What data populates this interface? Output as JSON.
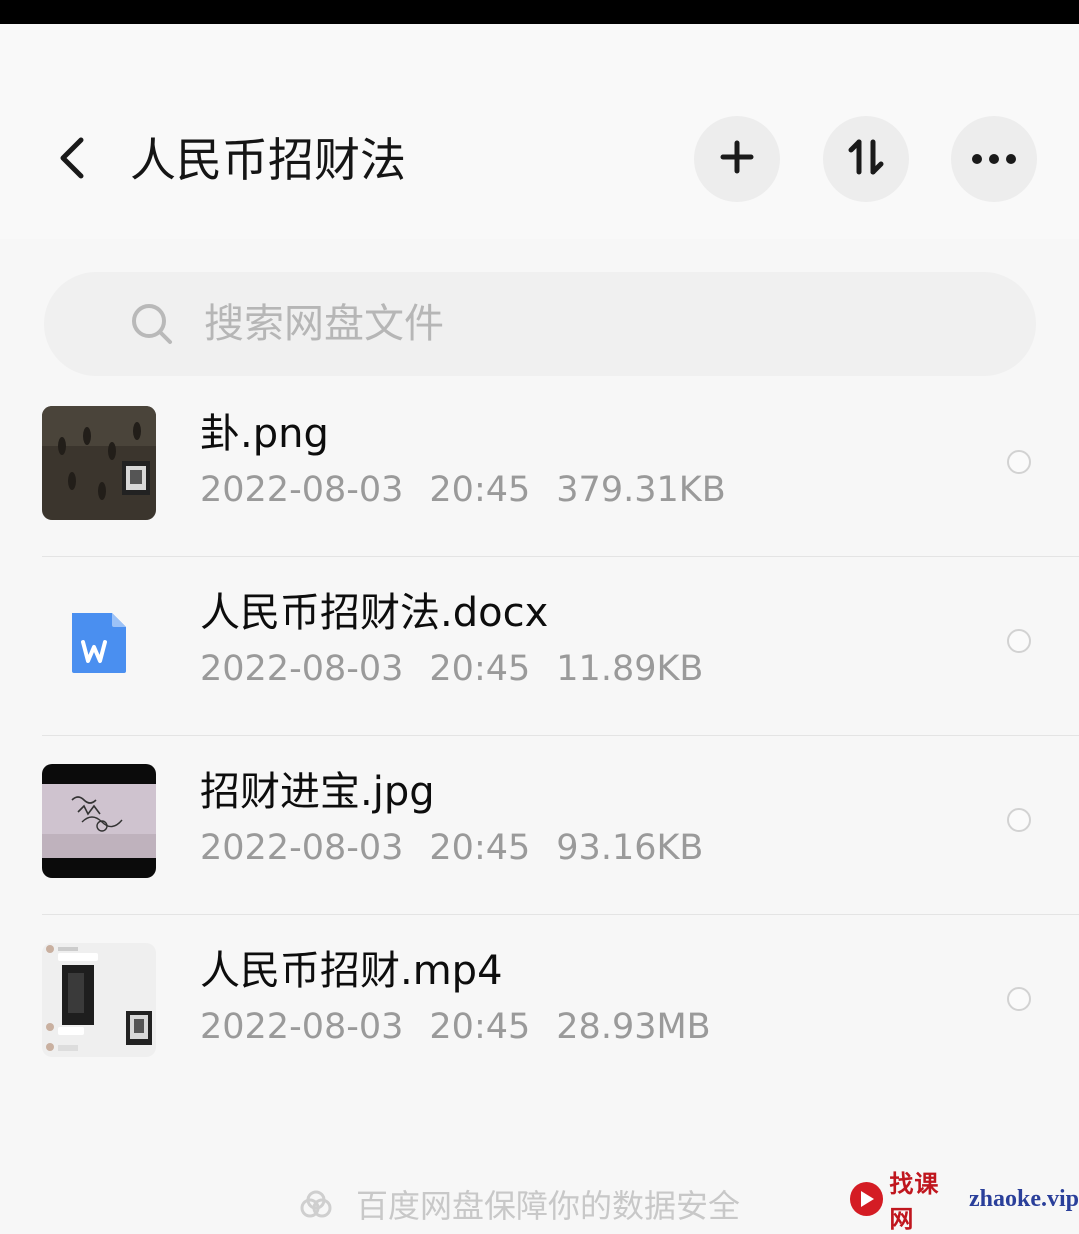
{
  "header": {
    "title": "人民币招财法"
  },
  "search": {
    "placeholder": "搜索网盘文件"
  },
  "files": [
    {
      "name": "卦.png",
      "date": "2022-08-03",
      "time": "20:45",
      "size": "379.31KB",
      "type": "image-thumbnail"
    },
    {
      "name": "人民币招财法.docx",
      "date": "2022-08-03",
      "time": "20:45",
      "size": "11.89KB",
      "type": "word-doc-icon"
    },
    {
      "name": "招财进宝.jpg",
      "date": "2022-08-03",
      "time": "20:45",
      "size": "93.16KB",
      "type": "image-thumbnail"
    },
    {
      "name": "人民币招财.mp4",
      "date": "2022-08-03",
      "time": "20:45",
      "size": "28.93MB",
      "type": "video-thumbnail"
    }
  ],
  "footer": {
    "text": "百度网盘保障你的数据安全"
  },
  "watermark": {
    "cn": "找课网",
    "en": "zhaoke.vip"
  },
  "colors": {
    "background": "#f7f7f7",
    "button_bg": "#ededed",
    "meta_text": "#9a9a9a",
    "word_icon": "#4a8ff0"
  }
}
